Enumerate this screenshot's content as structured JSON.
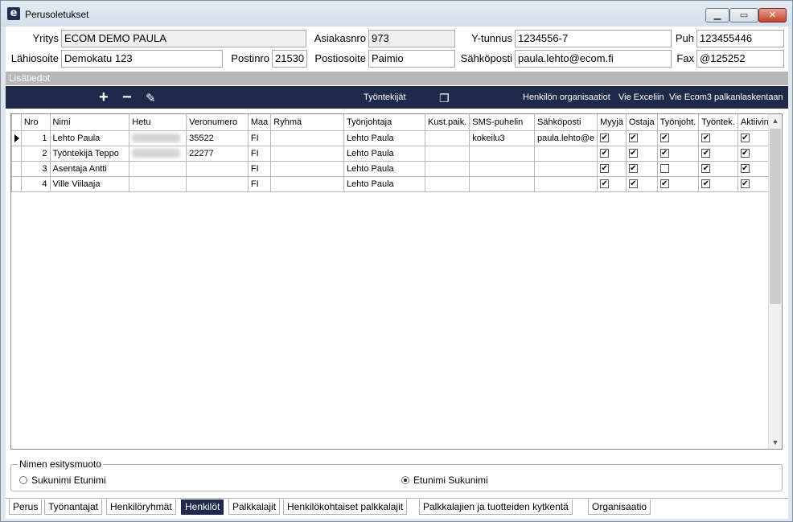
{
  "window": {
    "title": "Perusoletukset",
    "icon": "e-logo-icon"
  },
  "form": {
    "yritys_label": "Yritys",
    "yritys_value": "ECOM DEMO PAULA",
    "asiakasnro_label": "Asiakasnro",
    "asiakasnro_value": "973",
    "ytunnus_label": "Y-tunnus",
    "ytunnus_value": "1234556-7",
    "puh_label": "Puh",
    "puh_value": "123455446",
    "lahiosoite_label": "Lähiosoite",
    "lahiosoite_value": "Demokatu 123",
    "postinro_label": "Postinro",
    "postinro_value": "21530",
    "postiosoite_label": "Postiosoite",
    "postiosoite_value": "Paimio",
    "sahkoposti_label": "Sähköposti",
    "sahkoposti_value": "paula.lehto@ecom.fi",
    "fax_label": "Fax",
    "fax_value": "@125252"
  },
  "section": {
    "title": "Lisätiedot"
  },
  "toolbar": {
    "tyontekijat": "Työntekijät",
    "henkilon_organisaatiot": "Henkilön organisaatiot",
    "vie_exceliin": "Vie Exceliin",
    "vie_ecom3": "Vie Ecom3 palkanlaskentaan"
  },
  "grid": {
    "columns": [
      "Nro",
      "Nimi",
      "Hetu",
      "Veronumero",
      "Maa",
      "Ryhmä",
      "Työnjohtaja",
      "Kust.paik.",
      "SMS-puhelin",
      "Sähköposti",
      "Myyjä",
      "Ostaja",
      "Työnjoht.",
      "Työntek.",
      "Aktiivinen"
    ],
    "rows": [
      {
        "nro": "1",
        "nimi": "Lehto Paula",
        "veronumero": "35522",
        "maa": "FI",
        "ryhma": "",
        "tyonjohtaja": "Lehto Paula",
        "kustpaik": "",
        "sms": "kokeilu3",
        "email": "paula.lehto@e",
        "myyja": true,
        "ostaja": true,
        "tyonjoht": true,
        "tyontek": true,
        "aktiivinen": true
      },
      {
        "nro": "2",
        "nimi": "Työntekijä Teppo",
        "veronumero": "22277",
        "maa": "FI",
        "ryhma": "",
        "tyonjohtaja": "Lehto Paula",
        "kustpaik": "",
        "sms": "",
        "email": "",
        "myyja": true,
        "ostaja": true,
        "tyonjoht": true,
        "tyontek": true,
        "aktiivinen": true
      },
      {
        "nro": "3",
        "nimi": "Asentaja Antti",
        "veronumero": "",
        "maa": "FI",
        "ryhma": "",
        "tyonjohtaja": "Lehto Paula",
        "kustpaik": "",
        "sms": "",
        "email": "",
        "myyja": true,
        "ostaja": true,
        "tyonjoht": false,
        "tyontek": true,
        "aktiivinen": true
      },
      {
        "nro": "4",
        "nimi": "Ville Viilaaja",
        "veronumero": "",
        "maa": "FI",
        "ryhma": "",
        "tyonjohtaja": "Lehto Paula",
        "kustpaik": "",
        "sms": "",
        "email": "",
        "myyja": true,
        "ostaja": true,
        "tyonjoht": true,
        "tyontek": true,
        "aktiivinen": true
      }
    ]
  },
  "name_format": {
    "legend": "Nimen esitysmuoto",
    "option1": "Sukunimi Etunimi",
    "option2": "Etunimi Sukunimi",
    "selected": "Etunimi Sukunimi"
  },
  "tabs": [
    "Perus",
    "Työnantajat",
    "Henkilöryhmät",
    "Henkilöt",
    "Palkkalajit",
    "Henkilökohtaiset palkkalajit",
    "Palkkalajien ja tuotteiden kytkentä",
    "Organisaatio"
  ],
  "active_tab": "Henkilöt"
}
